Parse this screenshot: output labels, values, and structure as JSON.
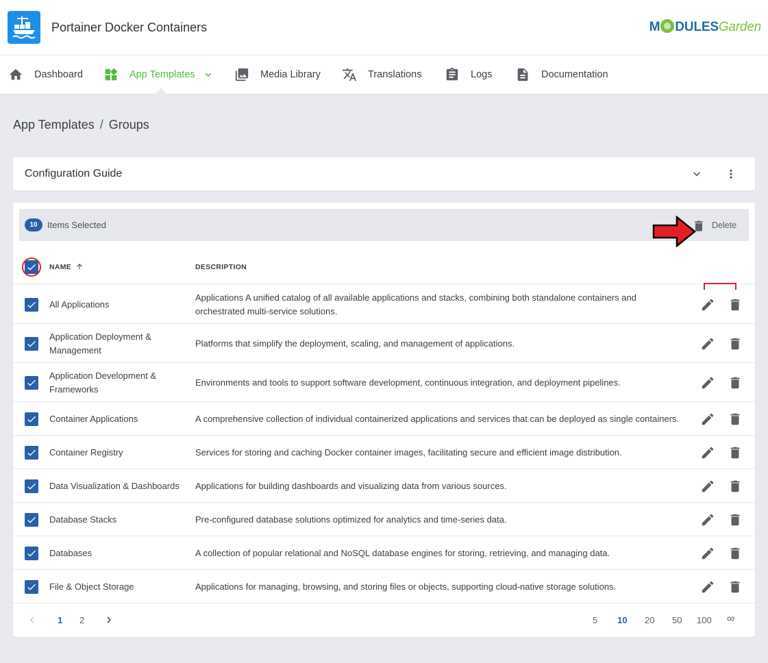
{
  "header": {
    "app_title": "Portainer Docker Containers",
    "brand": {
      "part1": "M",
      "part2": "DULES",
      "part3": "Garden"
    }
  },
  "nav": [
    {
      "label": "Dashboard",
      "icon": "home-icon"
    },
    {
      "label": "App Templates",
      "icon": "widgets-icon",
      "active": true,
      "has_dropdown": true
    },
    {
      "label": "Media Library",
      "icon": "photo-library-icon"
    },
    {
      "label": "Translations",
      "icon": "translate-icon"
    },
    {
      "label": "Logs",
      "icon": "clipboard-icon"
    },
    {
      "label": "Documentation",
      "icon": "document-icon"
    }
  ],
  "breadcrumb": {
    "root": "App Templates",
    "separator": "/",
    "current": "Groups"
  },
  "guide": {
    "title": "Configuration Guide"
  },
  "selection": {
    "count": "10",
    "label": "Items Selected",
    "delete_label": "Delete"
  },
  "table": {
    "columns": {
      "name": "NAME",
      "description": "DESCRIPTION"
    },
    "rows": [
      {
        "name": "All Applications",
        "description": "Applications A unified catalog of all available applications and stacks, combining both standalone containers and orchestrated multi-service solutions.",
        "checked": true
      },
      {
        "name": "Application Deployment & Management",
        "description": "Platforms that simplify the deployment, scaling, and management of applications.",
        "checked": true
      },
      {
        "name": "Application Development & Frameworks",
        "description": "Environments and tools to support software development, continuous integration, and deployment pipelines.",
        "checked": true
      },
      {
        "name": "Container Applications",
        "description": "A comprehensive collection of individual containerized applications and services that can be deployed as single containers.",
        "checked": true
      },
      {
        "name": "Container Registry",
        "description": "Services for storing and caching Docker container images, facilitating secure and efficient image distribution.",
        "checked": true
      },
      {
        "name": "Data Visualization & Dashboards",
        "description": "Applications for building dashboards and visualizing data from various sources.",
        "checked": true
      },
      {
        "name": "Database Stacks",
        "description": "Pre-configured database solutions optimized for analytics and time-series data.",
        "checked": true
      },
      {
        "name": "Databases",
        "description": "A collection of popular relational and NoSQL database engines for storing, retrieving, and managing data.",
        "checked": true
      },
      {
        "name": "File & Object Storage",
        "description": "Applications for managing, browsing, and storing files or objects, supporting cloud-native storage solutions.",
        "checked": true
      }
    ]
  },
  "pagination": {
    "pages": [
      "1",
      "2"
    ],
    "current_page": "1",
    "page_sizes": [
      "5",
      "10",
      "20",
      "50",
      "100",
      "∞"
    ],
    "current_size": "10"
  },
  "colors": {
    "accent_green": "#58b946",
    "primary_blue": "#2b5fa8",
    "annotation_red": "#d9262b"
  }
}
